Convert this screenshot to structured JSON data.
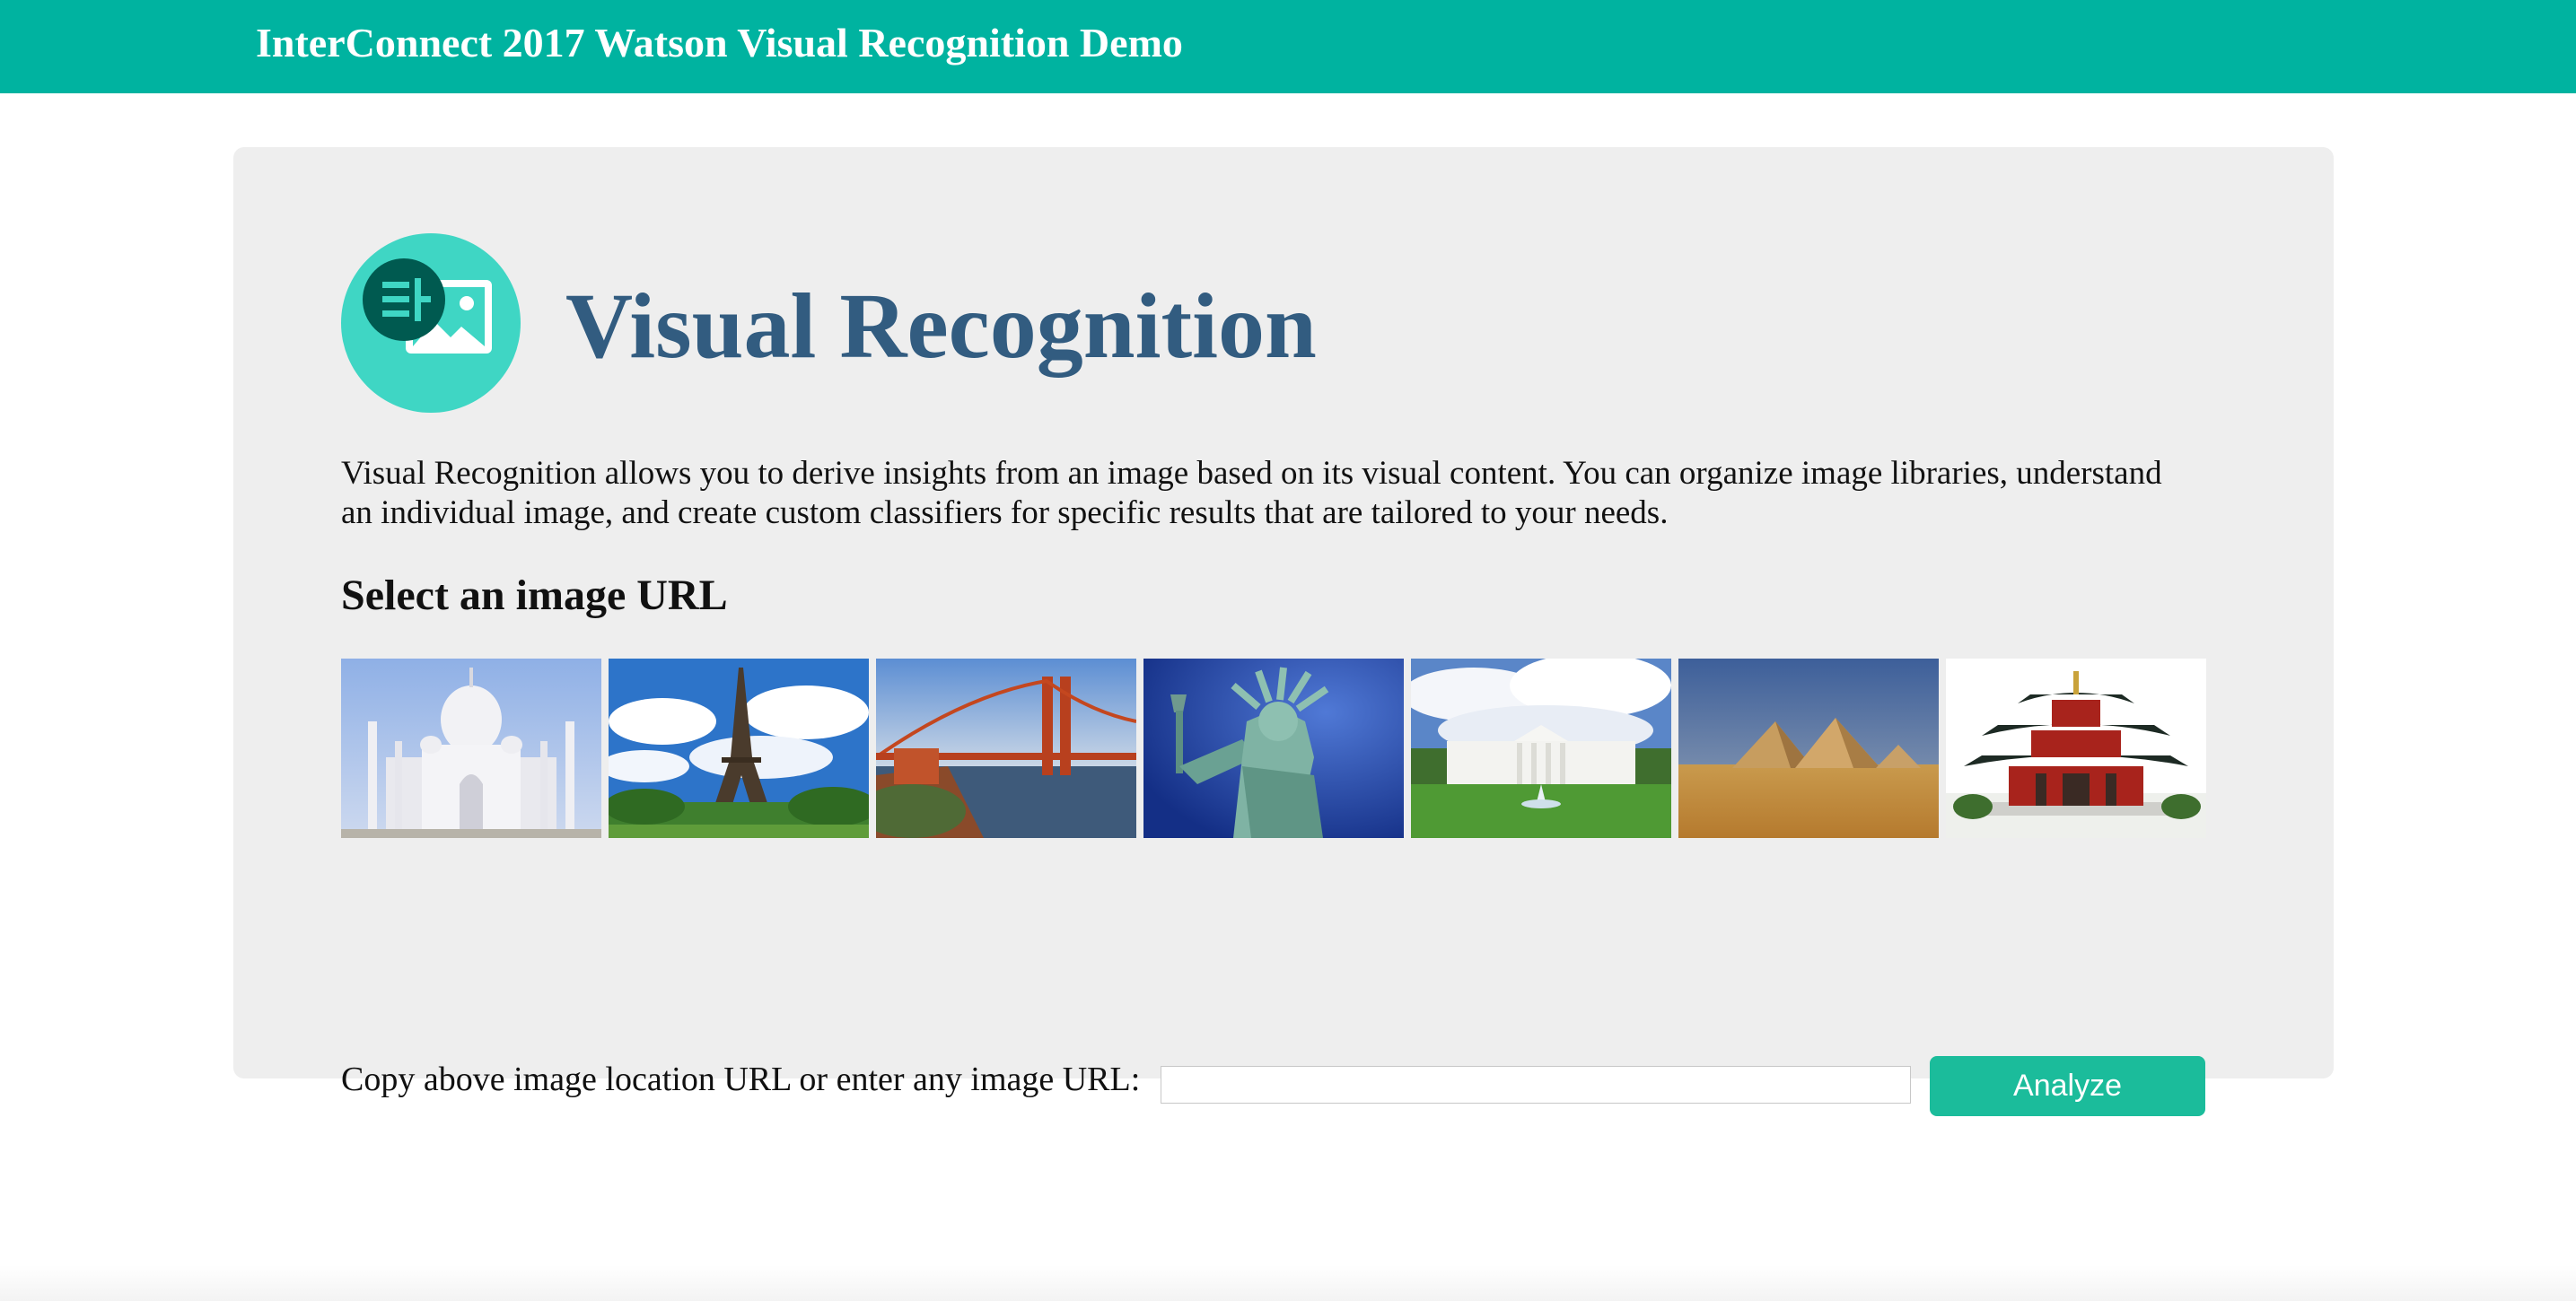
{
  "header": {
    "title": "InterConnect 2017 Watson Visual Recognition Demo"
  },
  "hero": {
    "logo_icon": "visual-recognition-logo-icon",
    "title": "Visual Recognition",
    "description": "Visual Recognition allows you to derive insights from an image based on its visual content. You can organize image libraries, understand an individual image, and create custom classifiers for specific results that are tailored to your needs."
  },
  "gallery": {
    "heading": "Select an image URL",
    "images": [
      {
        "subject": "taj-mahal"
      },
      {
        "subject": "eiffel-tower"
      },
      {
        "subject": "golden-gate-bridge"
      },
      {
        "subject": "statue-of-liberty"
      },
      {
        "subject": "white-house"
      },
      {
        "subject": "pyramids"
      },
      {
        "subject": "chinese-pagoda"
      }
    ]
  },
  "url_form": {
    "label": "Copy above image location URL or enter any image URL:",
    "value": "",
    "placeholder": "",
    "button_label": "Analyze"
  },
  "colors": {
    "brand_bar": "#00b3a0",
    "title": "#325c80",
    "button": "#1bbc9b",
    "panel": "#eeeeee"
  }
}
